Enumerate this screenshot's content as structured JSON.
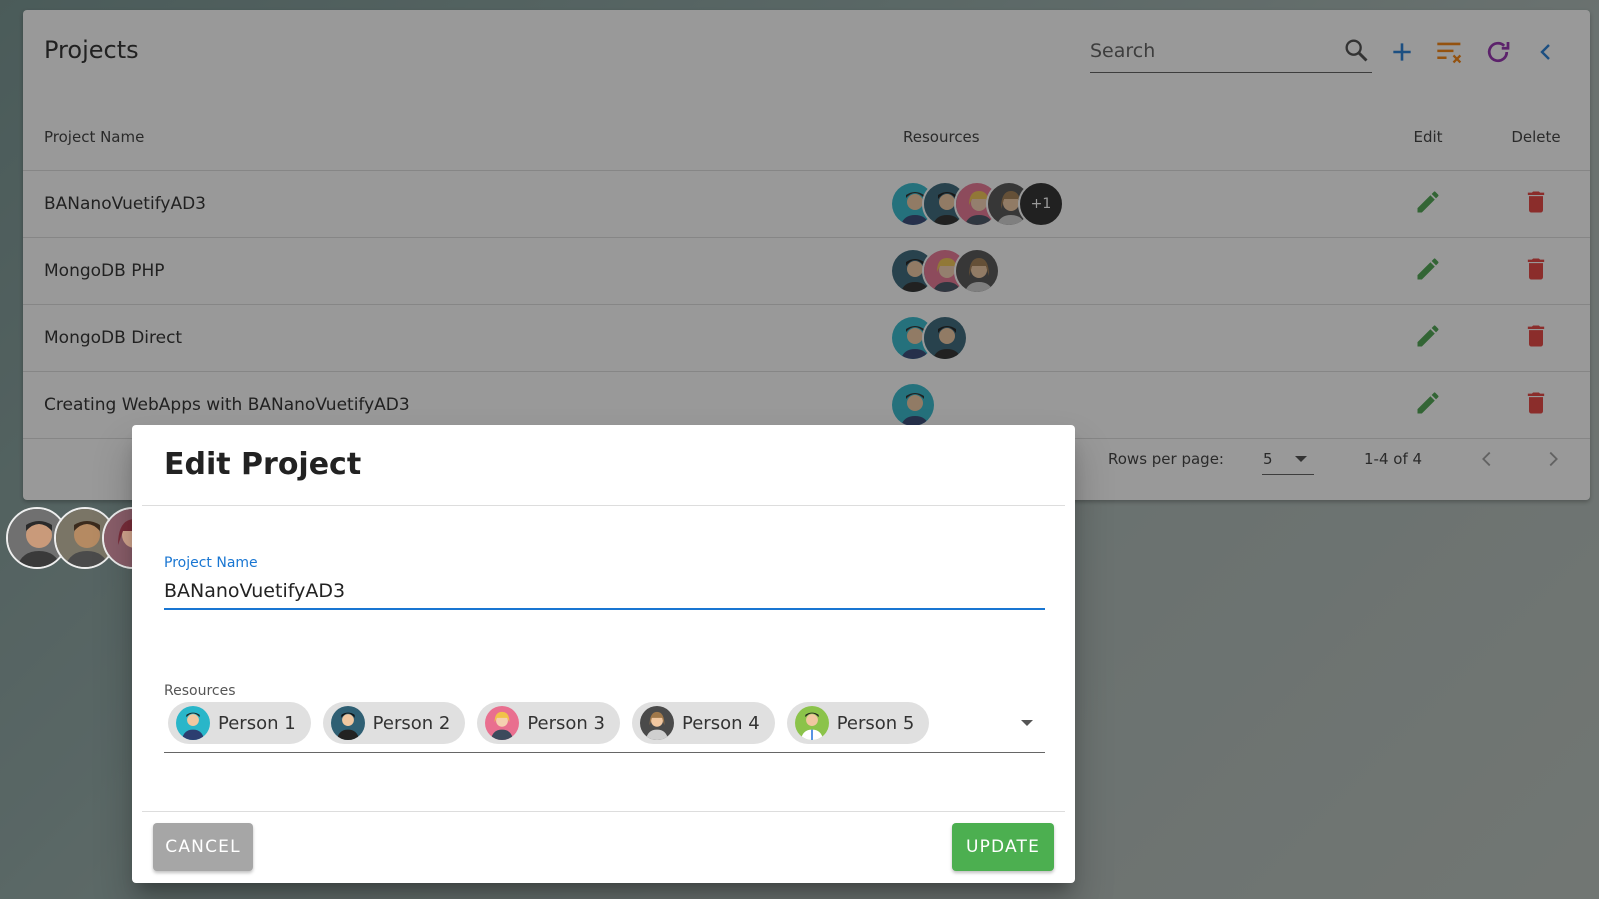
{
  "card": {
    "title": "Projects",
    "search_placeholder": "Search",
    "toolbar_icons": [
      "search-icon",
      "add-icon",
      "clear-filter-icon",
      "refresh-icon",
      "back-icon"
    ],
    "headers": {
      "name": "Project Name",
      "resources": "Resources",
      "edit": "Edit",
      "delete": "Delete"
    },
    "rows": [
      {
        "name": "BANanoVuetifyAD3",
        "extra": "+1"
      },
      {
        "name": "MongoDB PHP"
      },
      {
        "name": "MongoDB Direct"
      },
      {
        "name": "Creating WebApps with BANanoVuetifyAD3"
      }
    ],
    "footer": {
      "rows_per_page_label": "Rows per page:",
      "rows_per_page_value": "5",
      "range": "1-4 of 4"
    }
  },
  "dialog": {
    "title": "Edit Project",
    "project_name_label": "Project Name",
    "project_name_value": "BANanoVuetifyAD3",
    "resources_label": "Resources",
    "chips": [
      "Person 1",
      "Person 2",
      "Person 3",
      "Person 4",
      "Person 5"
    ],
    "cancel_label": "CANCEL",
    "update_label": "UPDATE"
  },
  "colors": {
    "primary": "#1976d2",
    "edit": "#43a047",
    "delete": "#e53935",
    "update_button": "#4caf50",
    "cancel_button": "#a6a6a6",
    "add_icon": "#1976d2",
    "filter_icon": "#f57c00",
    "refresh_icon": "#8e24aa"
  }
}
